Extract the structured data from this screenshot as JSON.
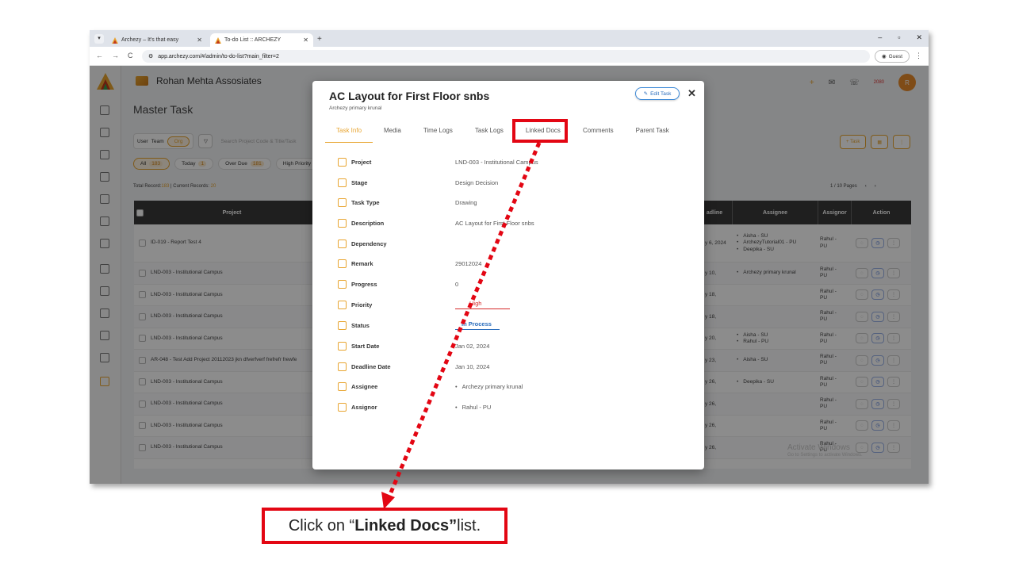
{
  "browser": {
    "tabs": [
      {
        "title": "Archezy – It's that easy"
      },
      {
        "title": "To-do List :: ARCHEZY"
      }
    ],
    "url": "app.archezy.com/#/admin/to-do-list?main_filter=2",
    "profile_label": "Guest"
  },
  "app": {
    "org_name": "Rohan Mehta Assosiates",
    "page_title": "Master Task",
    "coins": "2080",
    "avatar_initial": "R",
    "filters": {
      "seg_user": "User",
      "seg_team": "Team",
      "seg_org": "Org",
      "search_placeholder": "Search Project Code & Title/Task"
    },
    "chips": [
      {
        "label": "All",
        "count": "183"
      },
      {
        "label": "Today",
        "count": "1"
      },
      {
        "label": "Over Due",
        "count": "181"
      },
      {
        "label": "High Priority",
        "count": ""
      }
    ],
    "records": {
      "total_label": "Total Record:",
      "total": "183",
      "current_label": " | Current Records: ",
      "current": "20"
    },
    "pages": "1 / 10 Pages",
    "task_btn": "+ Task",
    "table": {
      "headers": {
        "project": "Project",
        "deadline": "adline",
        "assignee": "Assignee",
        "assignor": "Assignor",
        "action": "Action"
      },
      "rows": [
        {
          "project": "ID-019 - Report Test 4",
          "deadline": "y 6, 2024",
          "assignees": [
            "Aisha - SU",
            "ArchezyTutorial01 - PU",
            "Deepika - SU"
          ],
          "assignor": "Rahul - PU"
        },
        {
          "project": "LND-003 - Institutional Campus",
          "deadline": "y 10,",
          "assignees": [
            "Archezy primary krunal"
          ],
          "assignor": "Rahul - PU"
        },
        {
          "project": "LND-003 - Institutional Campus",
          "deadline": "y 18,",
          "assignees": [],
          "assignor": "Rahul - PU"
        },
        {
          "project": "LND-003 - Institutional Campus",
          "deadline": "y 18,",
          "assignees": [],
          "assignor": "Rahul - PU"
        },
        {
          "project": "LND-003 - Institutional Campus",
          "deadline": "y 20,",
          "assignees": [
            "Aisha - SU",
            "Rahul - PU"
          ],
          "assignor": "Rahul - PU"
        },
        {
          "project": "AR-048 - Test Add Project 20112023 jkn dfverfverf frefrefr frewfe",
          "deadline": "y 23,",
          "assignees": [
            "Aisha - SU"
          ],
          "assignor": "Rahul - PU"
        },
        {
          "project": "LND-003 - Institutional Campus",
          "deadline": "y 26,",
          "assignees": [
            "Deepika - SU"
          ],
          "assignor": "Rahul - PU"
        },
        {
          "project": "LND-003 - Institutional Campus",
          "deadline": "y 26,",
          "assignees": [],
          "assignor": "Rahul - PU"
        },
        {
          "project": "LND-003 - Institutional Campus",
          "deadline": "y 26,",
          "assignees": [],
          "assignor": "Rahul - PU"
        },
        {
          "project": "LND-003 - Institutional Campus",
          "deadline": "y 26,",
          "assignees": [],
          "assignor": "Rahul - PU"
        }
      ]
    },
    "watermark": {
      "line1": "Activate Windows",
      "line2": "Go to Settings to activate Windows."
    }
  },
  "modal": {
    "title": "AC Layout for First Floor snbs",
    "subtitle": "Archezy primary krunal",
    "edit_label": "Edit Task",
    "close_label": "✕",
    "tabs": [
      "Task Info",
      "Media",
      "Time Logs",
      "Task Logs",
      "Linked Docs",
      "Comments",
      "Parent Task"
    ],
    "fields": [
      {
        "label": "Project",
        "value": "LND-003 - Institutional Campus"
      },
      {
        "label": "Stage",
        "value": "Design Decision"
      },
      {
        "label": "Task Type",
        "value": "Drawing"
      },
      {
        "label": "Description",
        "value": "AC Layout for First Floor snbs"
      },
      {
        "label": "Dependency",
        "value": ""
      },
      {
        "label": "Remark",
        "value": "29012024"
      },
      {
        "label": "Progress",
        "value": "0"
      },
      {
        "label": "Priority",
        "value": "High"
      },
      {
        "label": "Status",
        "value": "In Process"
      },
      {
        "label": "Start Date",
        "value": "Jan 02, 2024"
      },
      {
        "label": "Deadline Date",
        "value": "Jan 10, 2024"
      },
      {
        "label": "Assignee",
        "value": "Archezy primary krunal"
      },
      {
        "label": "Assignor",
        "value": "Rahul - PU"
      }
    ]
  },
  "callout": {
    "prefix": "Click on “",
    "bold": "Linked Docs”",
    "suffix": " list."
  },
  "colors": {
    "accent": "#e8a531",
    "highlight_red": "#e30613",
    "link_blue": "#2a6dbd"
  }
}
